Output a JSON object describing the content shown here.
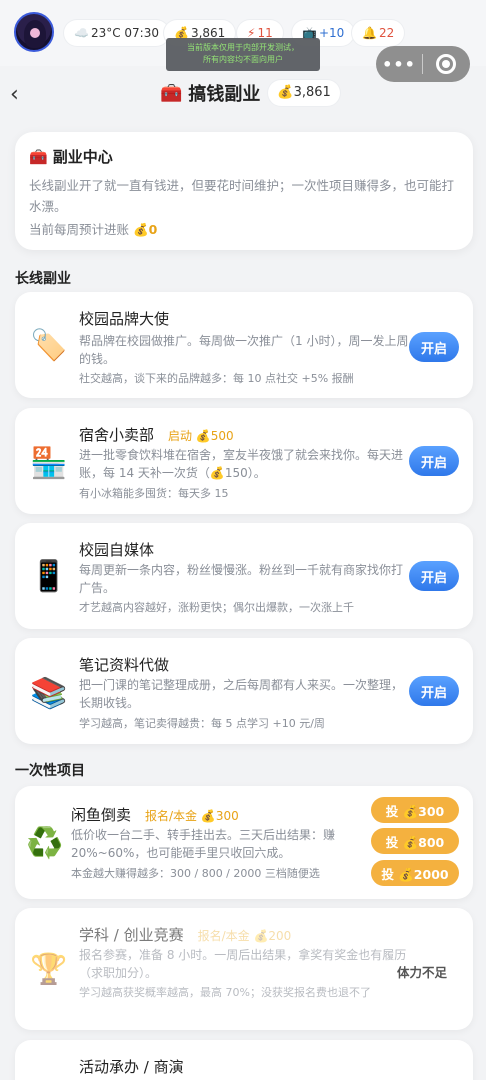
{
  "status_bar": {
    "weather": "23°C 07:30",
    "money": "3,861",
    "energy": "11",
    "tv": "+10",
    "alerts": "22"
  },
  "dev_notice": {
    "line1": "当前版本仅用于内部开发测试，",
    "line2": "所有内容均不面向用户"
  },
  "header": {
    "title": "搞钱副业",
    "money": "3,861"
  },
  "hub": {
    "title": "副业中心",
    "desc": "长线副业开了就一直有钱进，但要花时间维护；一次性项目赚得多，也可能打水漂。",
    "weekly_label": "当前每周预计进账",
    "weekly_value": "0"
  },
  "sections": {
    "long_term": "长线副业",
    "one_time": "一次性项目"
  },
  "long_term": [
    {
      "name": "校园品牌大使",
      "cost": "",
      "desc": "帮品牌在校园做推广。每周做一次推广（1 小时），周一发上周的钱。",
      "note": "社交越高，谈下来的品牌越多：每 10 点社交 +5% 报酬",
      "button": "开启"
    },
    {
      "name": "宿舍小卖部",
      "cost": "启动 💰500",
      "desc": "进一批零食饮料堆在宿舍，室友半夜饿了就会来找你。每天进账，每 14 天补一次货（💰150）。",
      "note": "有小冰箱能多囤货：每天多 15",
      "button": "开启"
    },
    {
      "name": "校园自媒体",
      "cost": "",
      "desc": "每周更新一条内容，粉丝慢慢涨。粉丝到一千就有商家找你打广告。",
      "note": "才艺越高内容越好，涨粉更快；偶尔出爆款，一次涨上千",
      "button": "开启"
    },
    {
      "name": "笔记资料代做",
      "cost": "",
      "desc": "把一门课的笔记整理成册，之后每周都有人来买。一次整理，长期收钱。",
      "note": "学习越高，笔记卖得越贵：每 5 点学习 +10 元/周",
      "button": "开启"
    }
  ],
  "one_time": [
    {
      "name": "闲鱼倒卖",
      "cost": "报名/本金 💰300",
      "desc": "低价收一台二手、转手挂出去。三天后出结果：赚 20%~60%，也可能砸手里只收回六成。",
      "note": "本金越大赚得越多：300 / 800 / 2000 三档随便选",
      "buttons": [
        "投 💰300",
        "投 💰800",
        "投 💰2000"
      ]
    },
    {
      "name": "学科 / 创业竞赛",
      "cost": "报名/本金 💰200",
      "desc": "报名参赛，准备 8 小时。一周后出结果，拿奖有奖金也有履历（求职加分）。",
      "note": "学习越高获奖概率越高，最高 70%；没获奖报名费也退不了",
      "status": "体力不足"
    },
    {
      "name": "活动承办 / 商演"
    }
  ],
  "icons": {
    "weather": "cloud-icon",
    "money": "money-bag-icon",
    "energy": "lightning-icon",
    "tv": "tv-icon",
    "alert": "bell-icon"
  }
}
